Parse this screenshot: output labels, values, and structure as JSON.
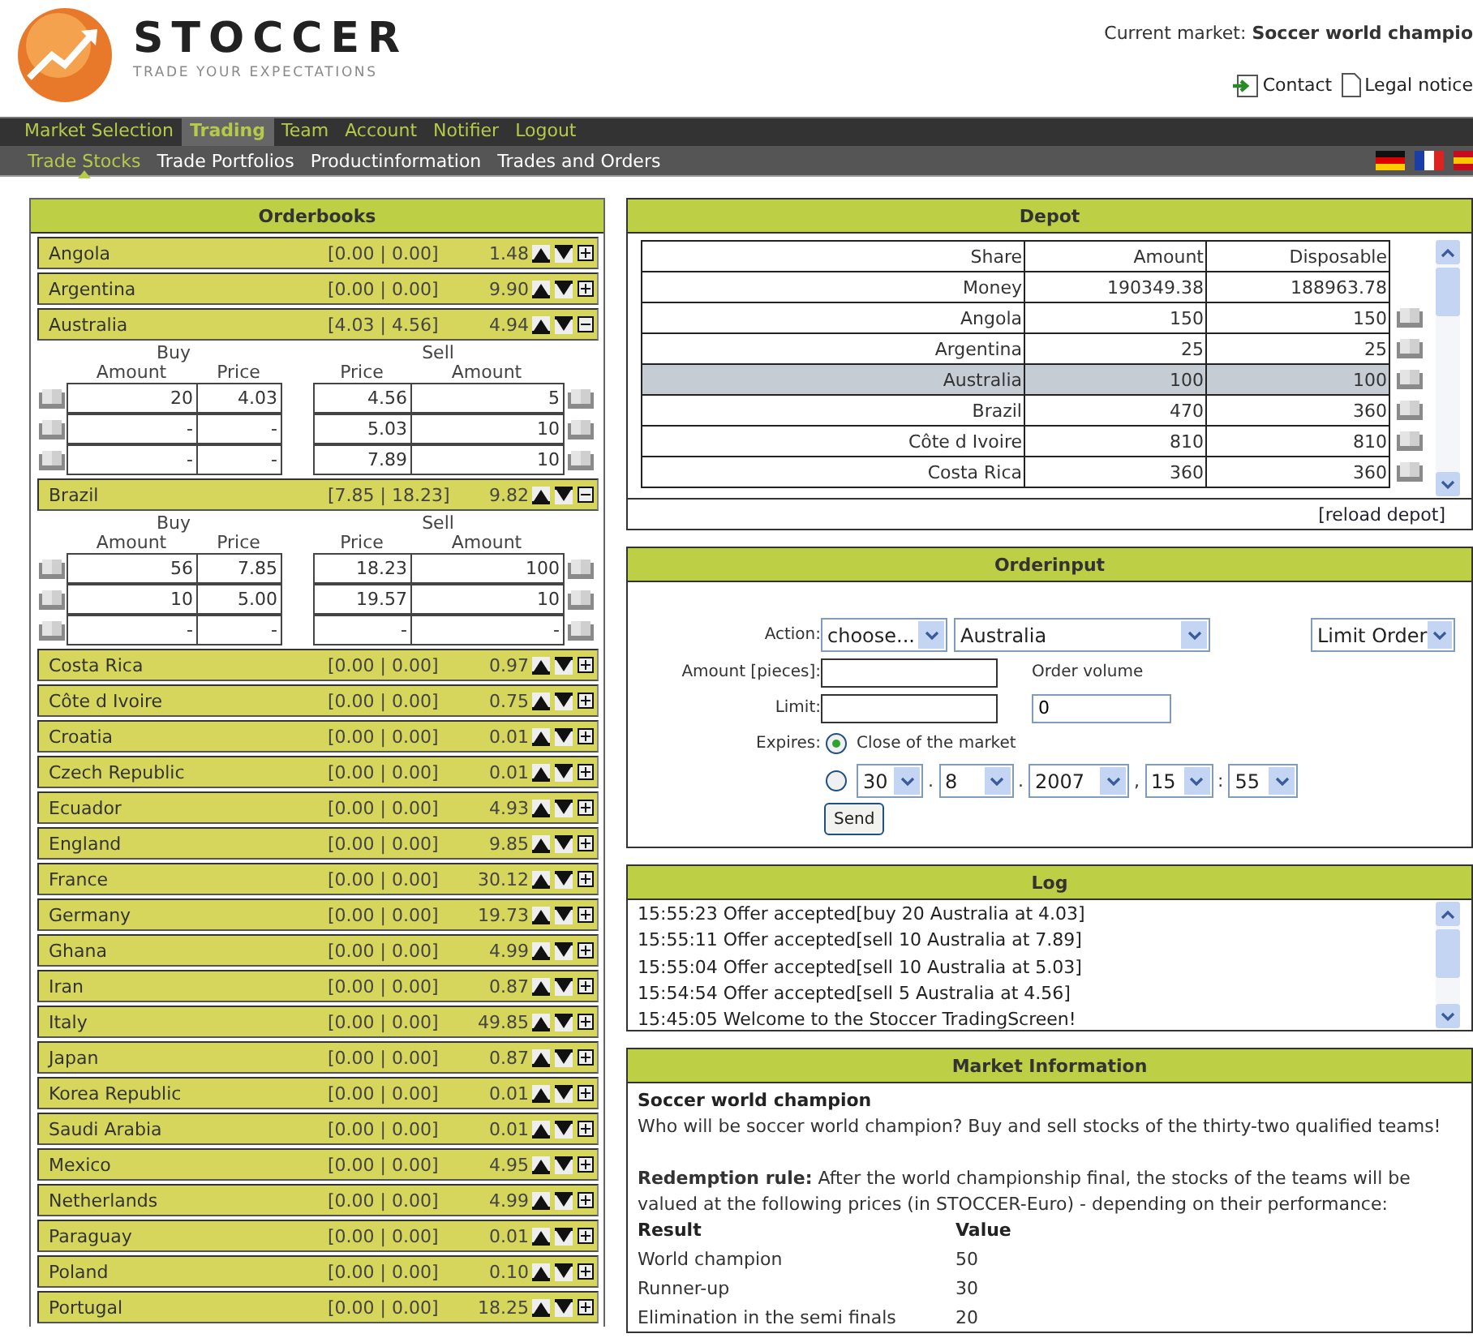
{
  "header": {
    "brand": "STOCCER",
    "tagline": "TRADE YOUR EXPECTATIONS",
    "market_label": "Current market:",
    "market_name": "Soccer world champio",
    "links": [
      {
        "label": "Contact",
        "kind": "contact"
      },
      {
        "label": "Legal notice",
        "kind": "document"
      }
    ]
  },
  "main_nav": [
    {
      "label": "Market Selection",
      "selected": false
    },
    {
      "label": "Trading",
      "selected": true
    },
    {
      "label": "Team",
      "selected": false
    },
    {
      "label": "Account",
      "selected": false
    },
    {
      "label": "Notifier",
      "selected": false
    },
    {
      "label": "Logout",
      "selected": false
    }
  ],
  "sub_nav": [
    {
      "label": "Trade Stocks",
      "selected": true
    },
    {
      "label": "Trade Portfolios",
      "selected": false
    },
    {
      "label": "Productinformation",
      "selected": false
    },
    {
      "label": "Trades and Orders",
      "selected": false
    }
  ],
  "languages": [
    {
      "kind": "de"
    },
    {
      "kind": "fr"
    },
    {
      "kind": "es"
    }
  ],
  "orderbooks": {
    "title": "Orderbooks",
    "items": [
      {
        "name": "Angola",
        "range": "[0.00 | 0.00]",
        "last": "1.48",
        "expanded": false
      },
      {
        "name": "Argentina",
        "range": "[0.00 | 0.00]",
        "last": "9.90",
        "expanded": false
      },
      {
        "name": "Australia",
        "range": "[4.03 | 4.56]",
        "last": "4.94",
        "expanded": true,
        "book": {
          "buy_label": "Buy",
          "buy_amount": "Amount",
          "buy_price": "Price",
          "sell_price": "Price",
          "sell_label": "Sell",
          "sell_amount": "Amount",
          "rows": [
            {
              "buy_amount": "20",
              "buy_price": "4.03",
              "sell_price": "4.56",
              "sell_amount": "5"
            },
            {
              "buy_amount": "-",
              "buy_price": "-",
              "sell_price": "5.03",
              "sell_amount": "10"
            },
            {
              "buy_amount": "-",
              "buy_price": "-",
              "sell_price": "7.89",
              "sell_amount": "10"
            }
          ]
        }
      },
      {
        "name": "Brazil",
        "range": "[7.85 | 18.23]",
        "last": "9.82",
        "expanded": true,
        "book": {
          "buy_label": "Buy",
          "buy_amount": "Amount",
          "buy_price": "Price",
          "sell_price": "Price",
          "sell_label": "Sell",
          "sell_amount": "Amount",
          "rows": [
            {
              "buy_amount": "56",
              "buy_price": "7.85",
              "sell_price": "18.23",
              "sell_amount": "100"
            },
            {
              "buy_amount": "10",
              "buy_price": "5.00",
              "sell_price": "19.57",
              "sell_amount": "10"
            },
            {
              "buy_amount": "-",
              "buy_price": "-",
              "sell_price": "-",
              "sell_amount": "-"
            }
          ]
        }
      },
      {
        "name": "Costa Rica",
        "range": "[0.00 | 0.00]",
        "last": "0.97",
        "expanded": false
      },
      {
        "name": "Côte d Ivoire",
        "range": "[0.00 | 0.00]",
        "last": "0.75",
        "expanded": false
      },
      {
        "name": "Croatia",
        "range": "[0.00 | 0.00]",
        "last": "0.01",
        "expanded": false
      },
      {
        "name": "Czech Republic",
        "range": "[0.00 | 0.00]",
        "last": "0.01",
        "expanded": false
      },
      {
        "name": "Ecuador",
        "range": "[0.00 | 0.00]",
        "last": "4.93",
        "expanded": false
      },
      {
        "name": "England",
        "range": "[0.00 | 0.00]",
        "last": "9.85",
        "expanded": false
      },
      {
        "name": "France",
        "range": "[0.00 | 0.00]",
        "last": "30.12",
        "expanded": false
      },
      {
        "name": "Germany",
        "range": "[0.00 | 0.00]",
        "last": "19.73",
        "expanded": false
      },
      {
        "name": "Ghana",
        "range": "[0.00 | 0.00]",
        "last": "4.99",
        "expanded": false
      },
      {
        "name": "Iran",
        "range": "[0.00 | 0.00]",
        "last": "0.87",
        "expanded": false
      },
      {
        "name": "Italy",
        "range": "[0.00 | 0.00]",
        "last": "49.85",
        "expanded": false
      },
      {
        "name": "Japan",
        "range": "[0.00 | 0.00]",
        "last": "0.87",
        "expanded": false
      },
      {
        "name": "Korea Republic",
        "range": "[0.00 | 0.00]",
        "last": "0.01",
        "expanded": false
      },
      {
        "name": "Saudi Arabia",
        "range": "[0.00 | 0.00]",
        "last": "0.01",
        "expanded": false
      },
      {
        "name": "Mexico",
        "range": "[0.00 | 0.00]",
        "last": "4.95",
        "expanded": false
      },
      {
        "name": "Netherlands",
        "range": "[0.00 | 0.00]",
        "last": "4.99",
        "expanded": false
      },
      {
        "name": "Paraguay",
        "range": "[0.00 | 0.00]",
        "last": "0.01",
        "expanded": false
      },
      {
        "name": "Poland",
        "range": "[0.00 | 0.00]",
        "last": "0.10",
        "expanded": false
      },
      {
        "name": "Portugal",
        "range": "[0.00 | 0.00]",
        "last": "18.25",
        "expanded": false
      }
    ]
  },
  "depot": {
    "title": "Depot",
    "columns": [
      "Share",
      "Amount",
      "Disposable"
    ],
    "money": {
      "share": "Money",
      "amount": "190349.38",
      "disposable": "188963.78"
    },
    "rows": [
      {
        "share": "Angola",
        "amount": "150",
        "disposable": "150",
        "selected": false
      },
      {
        "share": "Argentina",
        "amount": "25",
        "disposable": "25",
        "selected": false
      },
      {
        "share": "Australia",
        "amount": "100",
        "disposable": "100",
        "selected": true
      },
      {
        "share": "Brazil",
        "amount": "470",
        "disposable": "360",
        "selected": false
      },
      {
        "share": "Côte d Ivoire",
        "amount": "810",
        "disposable": "810",
        "selected": false
      },
      {
        "share": "Costa Rica",
        "amount": "360",
        "disposable": "360",
        "selected": false
      }
    ],
    "reload": "[reload depot]"
  },
  "orderinput": {
    "title": "Orderinput",
    "action_label": "Action:",
    "action": "choose...",
    "share": "Australia",
    "order_type": "Limit Order",
    "amount_label": "Amount [pieces]:",
    "volume_label": "Order volume",
    "limit_label": "Limit:",
    "volume": "0",
    "expires_label": "Expires:",
    "expiry_options": [
      {
        "kind": "close",
        "label": "Close of the market",
        "selected": true
      },
      {
        "kind": "date",
        "selected": false
      }
    ],
    "date_parts": [
      {
        "value": "30",
        "sep": "."
      },
      {
        "value": "8",
        "sep": "."
      },
      {
        "value": "2007",
        "sep": ","
      },
      {
        "value": "15",
        "sep": ":"
      },
      {
        "value": "55"
      }
    ],
    "send": "Send"
  },
  "log": {
    "title": "Log",
    "lines": [
      "15:55:23 Offer accepted[buy 20 Australia at 4.03]",
      "15:55:11 Offer accepted[sell 10 Australia at 7.89]",
      "15:55:04 Offer accepted[sell 10 Australia at 5.03]",
      "15:54:54 Offer accepted[sell 5 Australia at 4.56]",
      "15:45:05 Welcome to the Stoccer TradingScreen!"
    ]
  },
  "market_info": {
    "title": "Market Information",
    "name": "Soccer world champion",
    "description": "Who will be soccer world champion? Buy and sell stocks of the thirty-two qualified teams!",
    "rule": "**Redemption rule:** After the world championship final, the stocks of the teams will be valued at the following prices (in STOCCER-Euro) - depending on their performance:",
    "columns": [
      "Result",
      "Value"
    ],
    "rows": [
      {
        "result": "World champion",
        "value": "50"
      },
      {
        "result": "Runner-up",
        "value": "30"
      },
      {
        "result": "Elimination in the semi finals",
        "value": "20"
      }
    ]
  }
}
